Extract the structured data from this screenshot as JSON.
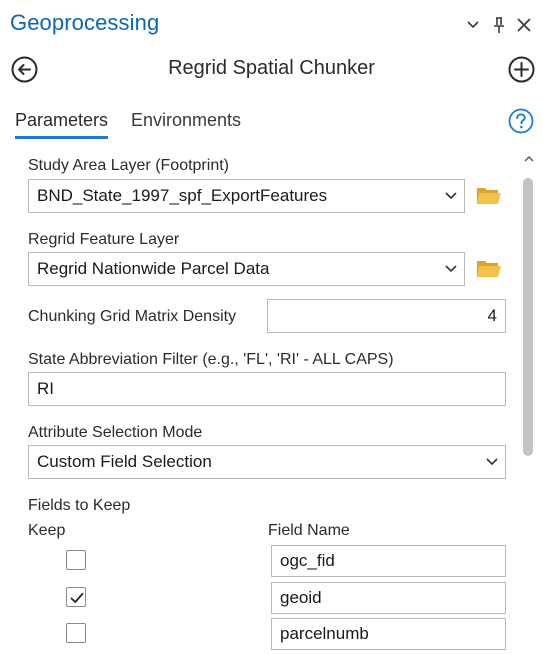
{
  "pane": {
    "title": "Geoprocessing",
    "icons": [
      "chevron-down-icon",
      "pin-icon",
      "close-icon"
    ]
  },
  "tool": {
    "title": "Regrid Spatial Chunker",
    "icons": [
      "back-arrow-icon",
      "add-circle-icon"
    ]
  },
  "tabs": [
    {
      "label": "Parameters",
      "active": true
    },
    {
      "label": "Environments",
      "active": false
    }
  ],
  "help_icon": "help-icon",
  "params": {
    "study_area": {
      "label": "Study Area Layer (Footprint)",
      "value": "BND_State_1997_spf_ExportFeatures"
    },
    "regrid_layer": {
      "label": "Regrid Feature Layer",
      "value": "Regrid Nationwide Parcel Data"
    },
    "grid_density": {
      "label": "Chunking Grid Matrix Density",
      "value": "4"
    },
    "state_filter": {
      "label": "State Abbreviation Filter (e.g., 'FL', 'RI' - ALL CAPS)",
      "value": "RI"
    },
    "selection_mode": {
      "label": "Attribute Selection Mode",
      "value": "Custom Field Selection"
    }
  },
  "fields_table": {
    "title": "Fields to Keep",
    "headers": {
      "keep": "Keep",
      "field_name": "Field Name"
    },
    "rows": [
      {
        "keep": false,
        "field_name": "ogc_fid"
      },
      {
        "keep": true,
        "field_name": "geoid"
      },
      {
        "keep": false,
        "field_name": "parcelnumb"
      }
    ]
  },
  "colors": {
    "title_blue": "#0b66b3",
    "tab_underline": "#1f7bd2",
    "help_blue": "#1f7bd2",
    "folder_yellow": "#e8b431",
    "border_gray": "#b9b9b9"
  }
}
